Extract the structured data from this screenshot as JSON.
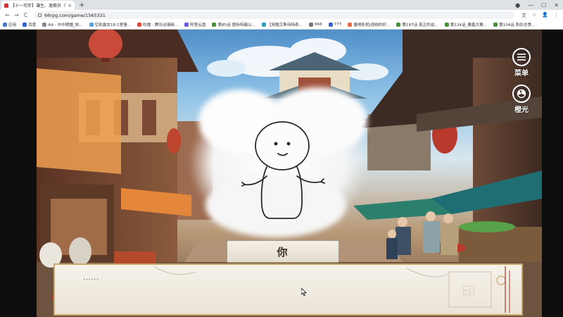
{
  "browser": {
    "tab_title": "【十一司伴】谦生、逸蝉员（有）",
    "tab_close": "×",
    "new_tab": "+",
    "url": "66rpg.com/game/1565331",
    "window_controls": [
      "●",
      "—",
      "☐",
      "✕"
    ],
    "nav": [
      "←",
      "→",
      "C"
    ],
    "toolbar_icons": [
      "文",
      "☆",
      "👤",
      "⋮"
    ]
  },
  "bookmarks": [
    {
      "label": "应用",
      "color": "#4a78c8"
    },
    {
      "label": "百度",
      "color": "#2f5fd0"
    },
    {
      "label": "AA · 中中期播_知...",
      "color": "#888"
    },
    {
      "label": "空影露女18.1里慢...",
      "color": "#5aa0e0"
    },
    {
      "label": "吃播 - 腾讯动漫画...",
      "color": "#e0463a"
    },
    {
      "label": "阿里云盘",
      "color": "#6a5cd8"
    },
    {
      "label": "第85话 暨特特霸山...",
      "color": "#4b8f3a"
    },
    {
      "label": "【来酷艾斯侍特奇...",
      "color": "#2aa0b8"
    },
    {
      "label": "666",
      "color": "#777"
    },
    {
      "label": "777",
      "color": "#3d62c9"
    },
    {
      "label": "番哩影视|视频的好...",
      "color": "#e36c3f"
    },
    {
      "label": "第187话 真正的战...",
      "color": "#4b8f3a"
    },
    {
      "label": "第224话_覆鑫大赛...",
      "color": "#4b8f3a"
    },
    {
      "label": "第104话 刺杀总季...",
      "color": "#4b8f3a"
    }
  ],
  "game": {
    "menu_label": "菜单",
    "auto_label": "橙光",
    "speaker": "你",
    "dialog_text": "......",
    "colors": {
      "frame_gold": "#c9a66a",
      "paper": "#f3eee5"
    }
  }
}
